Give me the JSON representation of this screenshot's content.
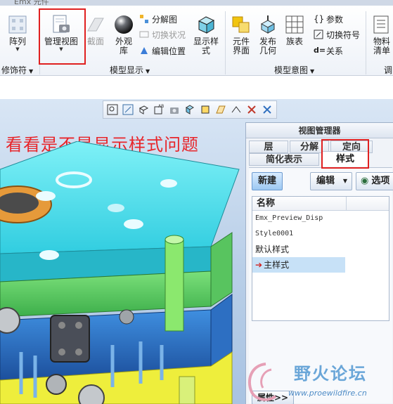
{
  "window": {
    "title": "Emx 元件"
  },
  "ribbon": {
    "buttons": {
      "array": "阵列",
      "manage_views": "管理视图",
      "section": "截面",
      "appearance_1": "外观",
      "appearance_2": "库",
      "display_style_1": "显示样",
      "display_style_2": "式",
      "element_1": "元件",
      "element_2": "界面",
      "publish_1": "发布",
      "publish_2": "几何",
      "family_table": "族表",
      "material_1": "物料",
      "material_2": "清单"
    },
    "small_items": {
      "exploded_view": "分解图",
      "toggle_status": "切换状况",
      "edit_position": "编辑位置",
      "parameters": "参数",
      "switch_symbol": "切换符号",
      "relations": "关系"
    },
    "groups": {
      "modifiers": "修饰符",
      "model_display": "模型显示",
      "model_intent": "模型意图",
      "investigate": "调"
    }
  },
  "annotation": "看看是不是显示样式问题",
  "view_manager": {
    "title": "视图管理器",
    "tabs": {
      "layers": "层",
      "explode": "分解",
      "orient": "定向",
      "simplified": "简化表示",
      "style": "样式"
    },
    "actions": {
      "new": "新建",
      "edit": "编辑",
      "options": "选项"
    },
    "list": {
      "header": "名称",
      "items": [
        "Emx_Preview_Disp",
        "Style0001",
        "默认样式",
        "主样式"
      ]
    },
    "properties": "属性>>"
  },
  "watermark": {
    "title": "野火论坛",
    "url": "www.proewildfire.cn"
  },
  "colors": {
    "highlight_red": "#e02020",
    "selection_blue": "#c7e1f7",
    "mold_cyan": "#34d6e6",
    "mold_green": "#5fd36a",
    "mold_blue": "#2a6fc9",
    "mold_yellow": "#f2f23a"
  }
}
